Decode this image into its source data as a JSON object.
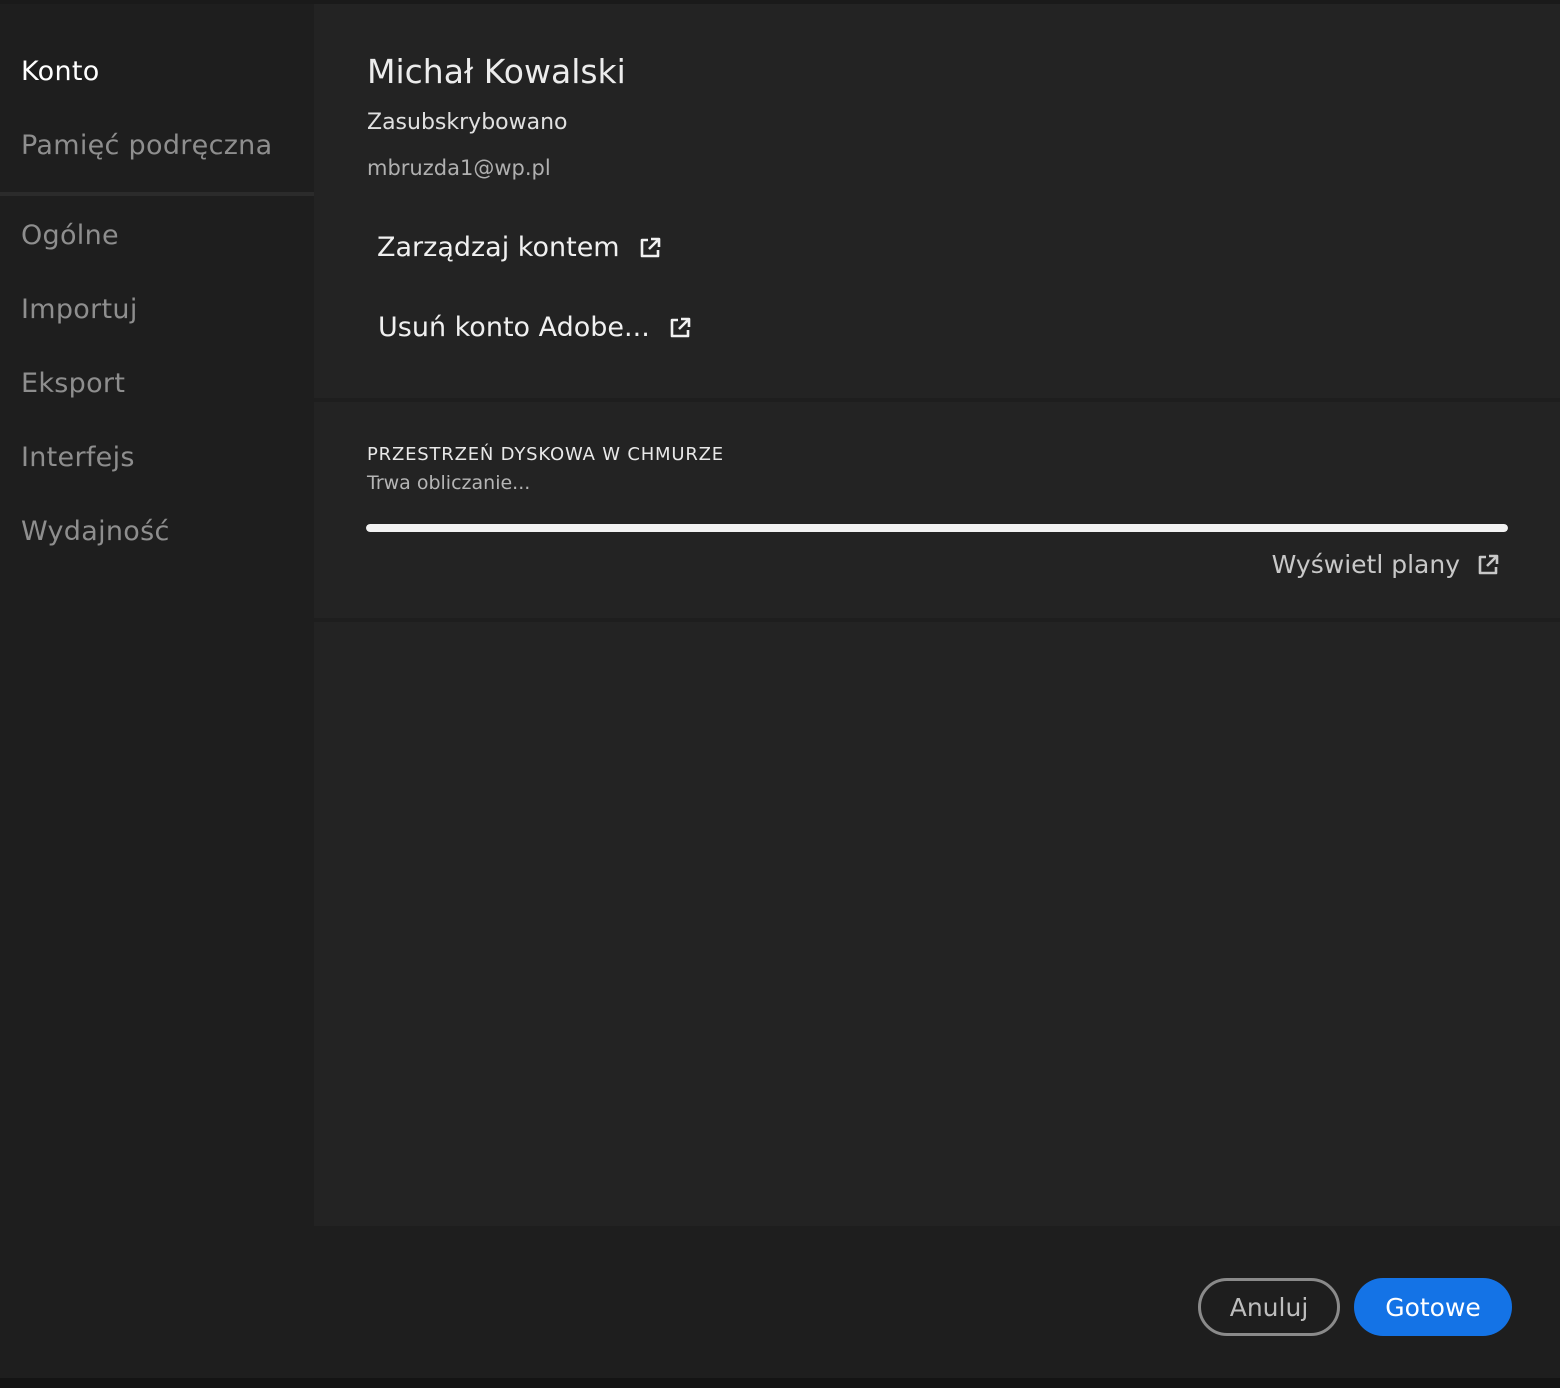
{
  "sidebar": {
    "items": [
      {
        "label": "Konto",
        "active": true
      },
      {
        "label": "Pamięć podręczna",
        "active": false
      },
      {
        "label": "Ogólne",
        "active": false
      },
      {
        "label": "Importuj",
        "active": false
      },
      {
        "label": "Eksport",
        "active": false
      },
      {
        "label": "Interfejs",
        "active": false
      },
      {
        "label": "Wydajność",
        "active": false
      }
    ]
  },
  "account": {
    "name": "Michał Kowalski",
    "status": "Zasubskrybowano",
    "email": "mbruzda1@wp.pl",
    "manage_label": "Zarządzaj kontem",
    "delete_label": "Usuń konto Adobe..."
  },
  "storage": {
    "title": "PRZESTRZEŃ DYSKOWA W CHMURZE",
    "status": "Trwa obliczanie...",
    "progress_percent": 100,
    "plans_label": "Wyświetl plany"
  },
  "footer": {
    "cancel_label": "Anuluj",
    "done_label": "Gotowe"
  },
  "icons": {
    "external_link": "external-link-icon"
  },
  "colors": {
    "accent": "#1473e6",
    "background": "#1e1e1e",
    "panel": "#232323"
  }
}
